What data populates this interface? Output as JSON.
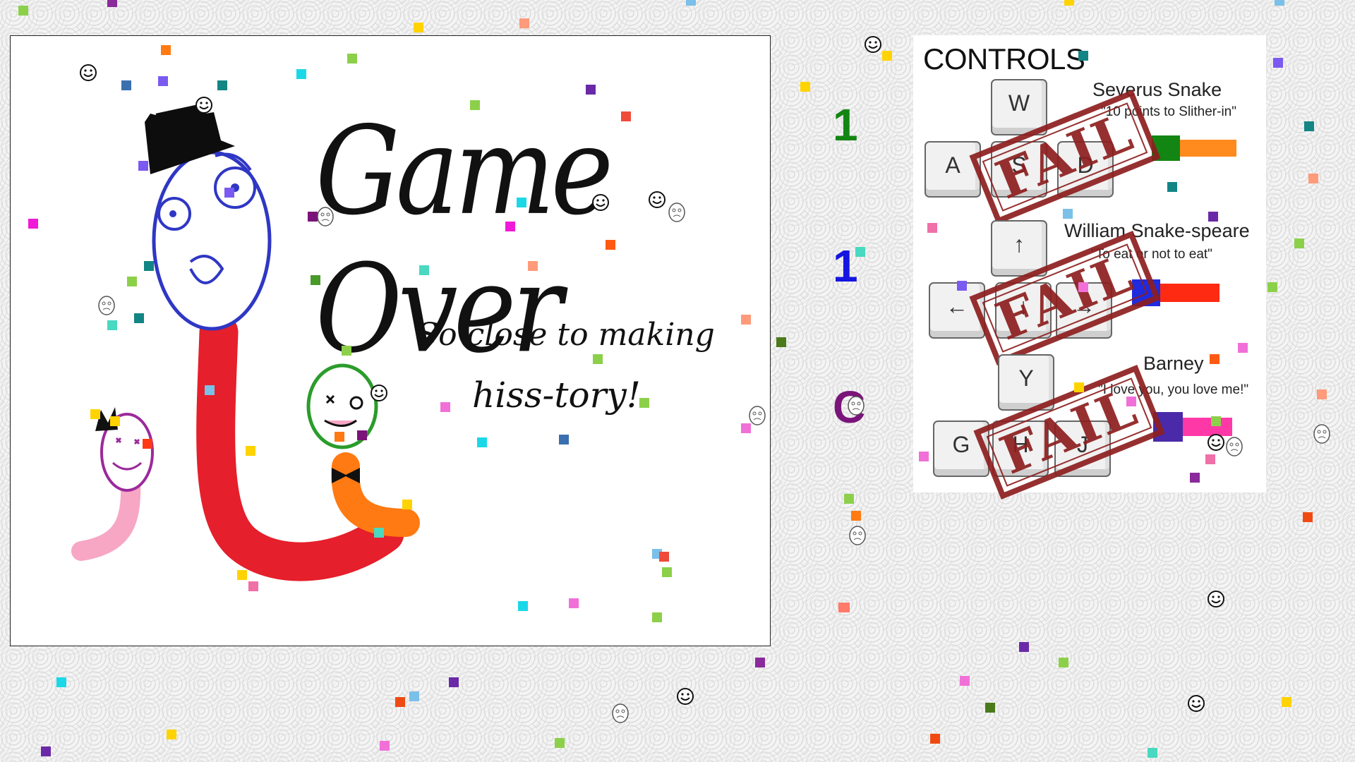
{
  "game_over": {
    "title": "Game Over",
    "subtitle_line1": "So close to making",
    "subtitle_line2": "hiss-tory!"
  },
  "scores": [
    {
      "value": "1",
      "color": "#138513"
    },
    {
      "value": "1",
      "color": "#1515e0"
    },
    {
      "value": "C",
      "color": "#7a147a"
    }
  ],
  "controls": {
    "title": "CONTROLS",
    "players": [
      {
        "name": "Severus Snake",
        "quote": "\"10 points to Slither-in\"",
        "keys": [
          "W",
          "A",
          "S",
          "D"
        ],
        "snake_color": "#ff8a1e",
        "head_color": "#138513",
        "stamp": "FAIL"
      },
      {
        "name": "William Snake-speare",
        "quote": "\"To eat or not to eat\"",
        "keys": [
          "↑",
          "←",
          "↓",
          "→"
        ],
        "snake_color": "#ff2a12",
        "head_color": "#1f2bdd",
        "stamp": "FAIL"
      },
      {
        "name": "Barney",
        "quote": "\"I love you, you love me!\"",
        "keys": [
          "Y",
          "G",
          "H",
          "J"
        ],
        "snake_color": "#ff38a8",
        "head_color": "#4a2aa8",
        "stamp": "FAIL"
      }
    ]
  }
}
